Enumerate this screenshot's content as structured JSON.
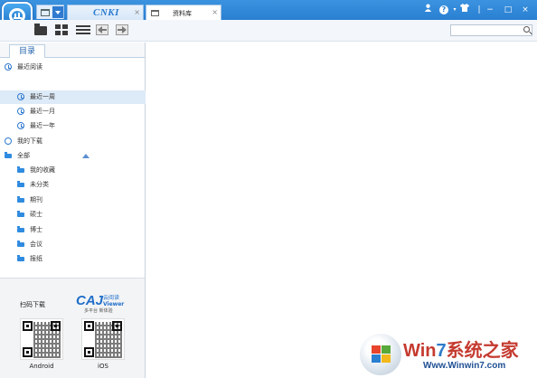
{
  "titlebar": {
    "tabs": [
      {
        "brand": "CNKI",
        "close": "×"
      },
      {
        "label": "资料库",
        "close": "×"
      }
    ],
    "controls": {
      "user": "user-icon",
      "help": "?",
      "skin": "shirt-icon",
      "minimize": "−",
      "maximize": "□",
      "close": "×"
    }
  },
  "toolbar": {
    "buttons": [
      "open-folder-icon",
      "grid-view-icon",
      "list-view-icon",
      "back-icon",
      "forward-icon"
    ],
    "search": {
      "value": "",
      "placeholder": ""
    }
  },
  "sidebar": {
    "tab_label": "目录",
    "tree": [
      {
        "label": "最近阅读",
        "icon": "clock-icon",
        "level": 0
      },
      {
        "label": "最近一周",
        "icon": "clock-icon",
        "level": 1,
        "selected": true
      },
      {
        "label": "最近一月",
        "icon": "clock-icon",
        "level": 1
      },
      {
        "label": "最近一年",
        "icon": "clock-icon",
        "level": 1
      },
      {
        "label": "我的下载",
        "icon": "download-icon",
        "level": 0
      },
      {
        "label": "全部",
        "icon": "folder-icon",
        "level": 0
      },
      {
        "label": "我的收藏",
        "icon": "folder-icon",
        "level": 1
      },
      {
        "label": "未分类",
        "icon": "folder-icon",
        "level": 1
      },
      {
        "label": "期刊",
        "icon": "folder-icon",
        "level": 1
      },
      {
        "label": "硕士",
        "icon": "folder-icon",
        "level": 1
      },
      {
        "label": "博士",
        "icon": "folder-icon",
        "level": 1
      },
      {
        "label": "会议",
        "icon": "folder-icon",
        "level": 1
      },
      {
        "label": "报纸",
        "icon": "folder-icon",
        "level": 1
      }
    ],
    "promo": {
      "scan_label": "扫码下载",
      "caj_logo": "CAJ",
      "caj_name": "云阅读",
      "caj_viewer": "Viewer",
      "caj_tagline": "多平台 新体验",
      "qr_android": "Android",
      "qr_ios": "iOS"
    }
  },
  "watermark": {
    "title_prefix": "Win",
    "title_seven": "7",
    "title_suffix": "系统之家",
    "url": "Www.Winwin7.com"
  },
  "colors": {
    "accent": "#2a7fd1",
    "selected_row": "#ddeaf7",
    "watermark_red": "#c53a2f"
  }
}
